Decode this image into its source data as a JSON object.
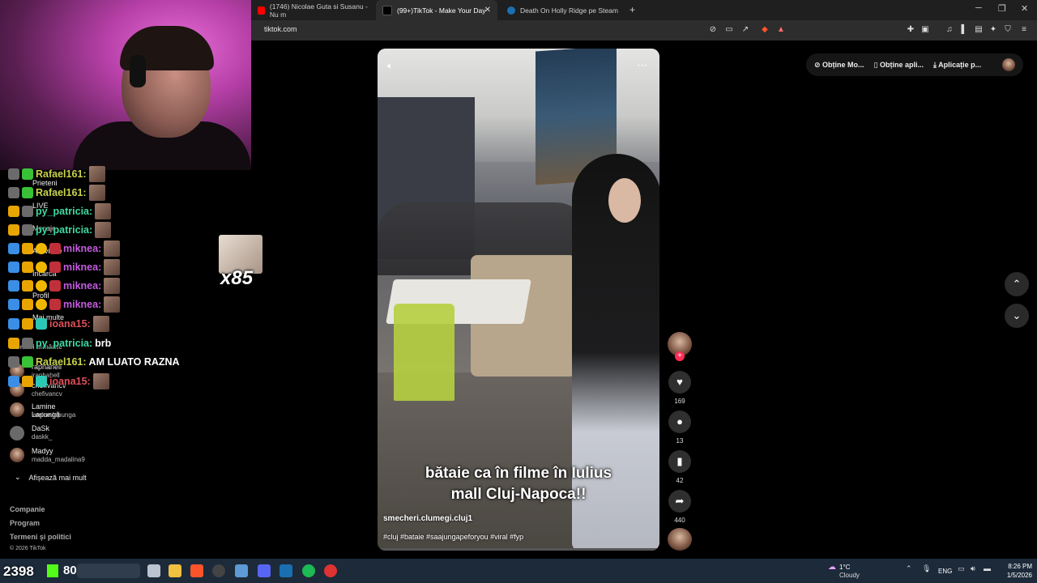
{
  "browser": {
    "tabs": [
      {
        "label": "(1746) Nicolae Guta si Susanu - Nu m",
        "active": false,
        "icon": "youtube-icon"
      },
      {
        "label": "(99+)TikTok - Make Your Day",
        "active": true,
        "icon": "tiktok-icon"
      },
      {
        "label": "Death On Holly Ridge pe Steam",
        "active": false,
        "icon": "steam-icon"
      }
    ],
    "new_tab": "+",
    "url": "tiktok.com"
  },
  "tiktok": {
    "top_actions": [
      "Obține Mo...",
      "Obține apli...",
      "Aplicație p..."
    ],
    "video": {
      "caption_line1": "bătaie ca în filme în Iulius",
      "caption_line2": "mall Cluj-Napoca!!",
      "author": "smecheri.clumegi.cluj1",
      "hashtags": "#cluj #bataie #saajungapeforyou #viral #fyp"
    },
    "actions": {
      "likes": "169",
      "comments": "13",
      "saves": "42",
      "shares": "440"
    },
    "sidebar": {
      "nav": [
        "Prieteni",
        "LIVE",
        "Mesaje",
        "Activitate",
        "Încarcă",
        "Profil",
        "Mai multe"
      ],
      "following_heading": "Conturi urmărite",
      "accounts": [
        {
          "name": "raphahell",
          "handle": "iraphahell"
        },
        {
          "name": "chefivancv",
          "handle": "chefivancv"
        },
        {
          "name": "Lamine Lapungă",
          "handle": "lamine.lapunga"
        },
        {
          "name": "DaSk",
          "handle": "daskk_"
        },
        {
          "name": "Madyy",
          "handle": "madda_madalina9"
        }
      ],
      "show_more": "Afișează mai mult",
      "footer": [
        "Companie",
        "Program",
        "Termeni și politici"
      ],
      "footer_sub": "© 2026 TikTok"
    }
  },
  "chat": [
    {
      "user": "Rafael161:",
      "msg": "",
      "color": "#c8d34a",
      "emote": true
    },
    {
      "user": "Rafael161:",
      "msg": "",
      "color": "#c8d34a",
      "emote": true
    },
    {
      "user": "py_patricia:",
      "msg": "",
      "color": "#3fd9a0",
      "emote": true
    },
    {
      "user": "py_patricia:",
      "msg": "",
      "color": "#3fd9a0",
      "emote": true
    },
    {
      "user": "miknea:",
      "msg": "",
      "color": "#c45be0",
      "emote": true
    },
    {
      "user": "miknea:",
      "msg": "",
      "color": "#c45be0",
      "emote": true
    },
    {
      "user": "miknea:",
      "msg": "",
      "color": "#c45be0",
      "emote": true
    },
    {
      "user": "miknea:",
      "msg": "",
      "color": "#c45be0",
      "emote": true
    },
    {
      "user": "ioana15:",
      "msg": "",
      "color": "#e0505a",
      "emote": true
    },
    {
      "user": "py_patricia:",
      "msg": "brb",
      "color": "#3fd9a0",
      "emote": false
    },
    {
      "user": "Rafael161:",
      "msg": "AM LUATO RAZNA",
      "color": "#c8d34a",
      "emote": false
    },
    {
      "user": "ioana15:",
      "msg": "",
      "color": "#e0505a",
      "emote": true
    }
  ],
  "emote_combo": "x85",
  "stream_stats": {
    "viewers": "2398",
    "followers": "80"
  },
  "taskbar": {
    "weather_temp": "1°C",
    "weather_desc": "Cloudy",
    "language": "ENG",
    "time": "8:26 PM",
    "date": "1/5/2026"
  },
  "colors": {
    "accent": "#fe2c55",
    "kick_green": "#53fc18",
    "taskbar": "#1c2a3a"
  }
}
